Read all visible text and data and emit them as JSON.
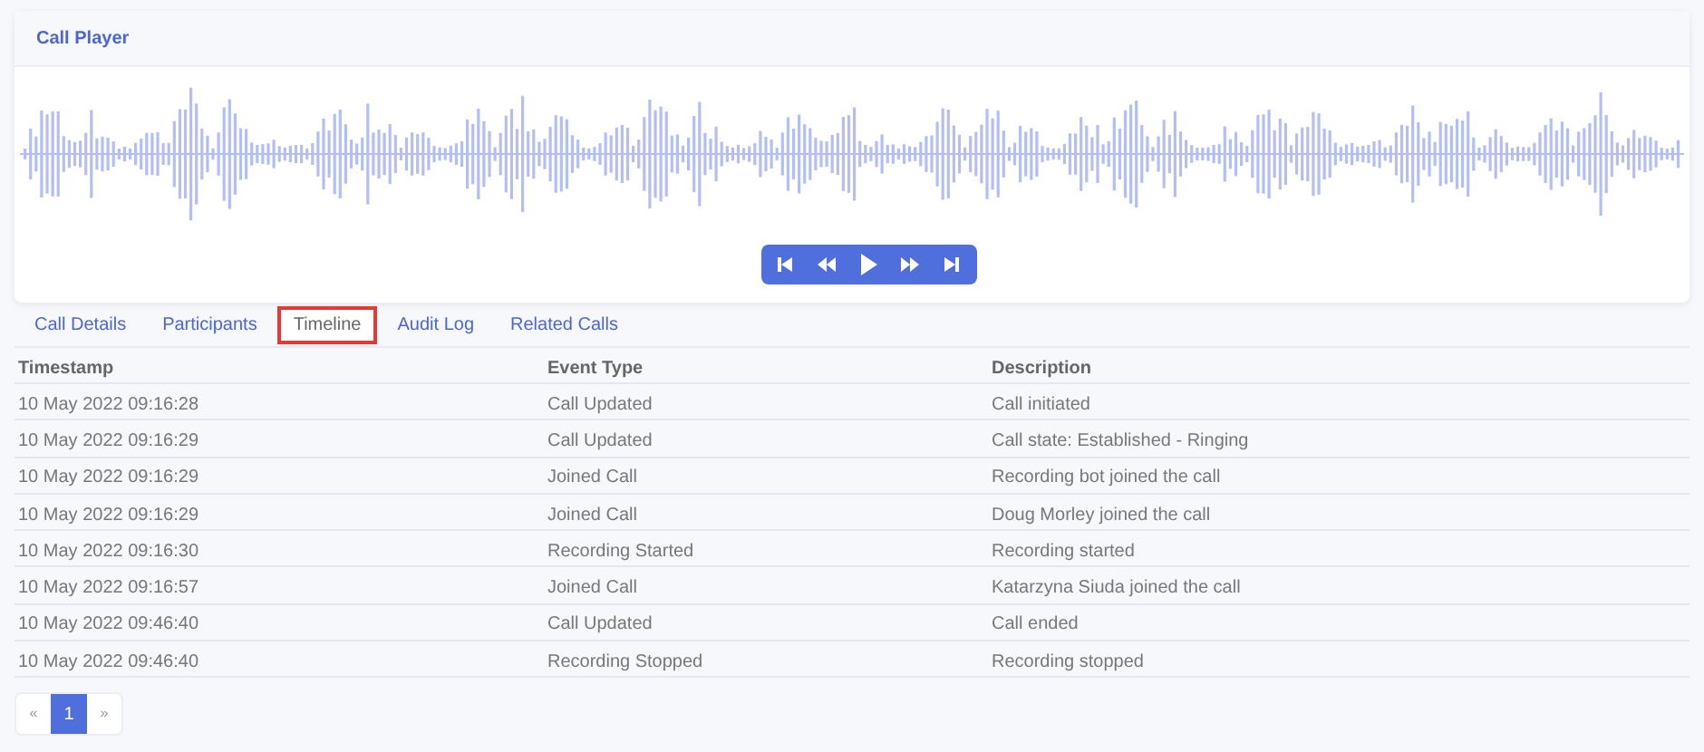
{
  "player": {
    "title": "Call Player",
    "controls": [
      {
        "kind": "start"
      },
      {
        "kind": "rewind"
      },
      {
        "kind": "play"
      },
      {
        "kind": "forward"
      },
      {
        "kind": "end"
      }
    ]
  },
  "tabs": [
    {
      "label": "Call Details",
      "selected": false
    },
    {
      "label": "Participants",
      "selected": false
    },
    {
      "label": "Timeline",
      "selected": true
    },
    {
      "label": "Audit Log",
      "selected": false
    },
    {
      "label": "Related Calls",
      "selected": false
    }
  ],
  "table": {
    "columns": [
      "Timestamp",
      "Event Type",
      "Description"
    ],
    "rows": [
      [
        "10 May 2022 09:16:28",
        "Call Updated",
        "Call initiated"
      ],
      [
        "10 May 2022 09:16:29",
        "Call Updated",
        "Call state: Established - Ringing"
      ],
      [
        "10 May 2022 09:16:29",
        "Joined Call",
        "Recording bot joined the call"
      ],
      [
        "10 May 2022 09:16:29",
        "Joined Call",
        "Doug Morley joined the call"
      ],
      [
        "10 May 2022 09:16:30",
        "Recording Started",
        "Recording started"
      ],
      [
        "10 May 2022 09:16:57",
        "Joined Call",
        "Katarzyna Siuda joined the call"
      ],
      [
        "10 May 2022 09:46:40",
        "Call Updated",
        "Call ended"
      ],
      [
        "10 May 2022 09:46:40",
        "Recording Stopped",
        "Recording stopped"
      ]
    ]
  },
  "pagination": [
    {
      "label": "«",
      "selected": false
    },
    {
      "label": "1",
      "selected": true
    },
    {
      "label": "»",
      "selected": false
    }
  ]
}
